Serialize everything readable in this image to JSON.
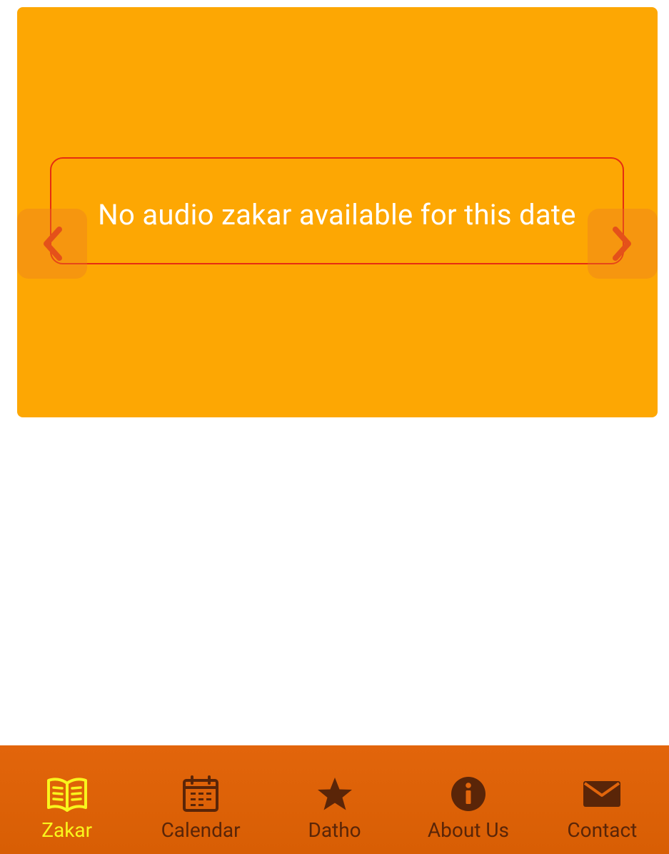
{
  "player": {
    "message": "No audio zakar available for this date",
    "prev_icon": "chevron-left-icon",
    "next_icon": "chevron-right-icon"
  },
  "bottom_nav": {
    "items": [
      {
        "label": "Zakar",
        "icon": "book-open-icon",
        "active": true
      },
      {
        "label": "Calendar",
        "icon": "calendar-icon",
        "active": false
      },
      {
        "label": "Datho",
        "icon": "star-icon",
        "active": false
      },
      {
        "label": "About Us",
        "icon": "info-icon",
        "active": false
      },
      {
        "label": "Contact",
        "icon": "envelope-icon",
        "active": false
      }
    ]
  },
  "colors": {
    "card_background": "#fda703",
    "message_border": "#e52d12",
    "arrow": "#e4511a",
    "nav_background": "#e2650b",
    "nav_active": "#f9f51d",
    "nav_inactive": "#5a2508"
  }
}
